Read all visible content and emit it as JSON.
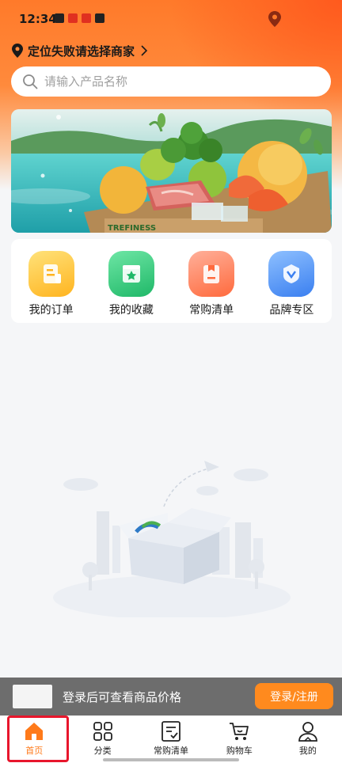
{
  "status": {
    "time": "12:34"
  },
  "location": {
    "text": "定位失败请选择商家"
  },
  "search": {
    "placeholder": "请输入产品名称"
  },
  "banner": {
    "crate_text": "TREFINESS"
  },
  "quick_actions": [
    {
      "label": "我的订单",
      "icon": "order-icon",
      "color": "#ffc23a"
    },
    {
      "label": "我的收藏",
      "icon": "favorite-icon",
      "color": "#2fc97a"
    },
    {
      "label": "常购清单",
      "icon": "shopping-list-icon",
      "color": "#ff8057"
    },
    {
      "label": "品牌专区",
      "icon": "brand-icon",
      "color": "#4b8ff5"
    }
  ],
  "login_prompt": {
    "text": "登录后可查看商品价格",
    "button": "登录/注册"
  },
  "tabs": [
    {
      "label": "首页",
      "icon": "home-icon",
      "active": true
    },
    {
      "label": "分类",
      "icon": "category-icon",
      "active": false
    },
    {
      "label": "常购清单",
      "icon": "list-icon",
      "active": false
    },
    {
      "label": "购物车",
      "icon": "cart-icon",
      "active": false
    },
    {
      "label": "我的",
      "icon": "profile-icon",
      "active": false
    }
  ],
  "colors": {
    "accent": "#ff7a1a",
    "header": "#ff7a2a",
    "login_button": "#ff8a1e",
    "highlight": "#e8162c"
  }
}
